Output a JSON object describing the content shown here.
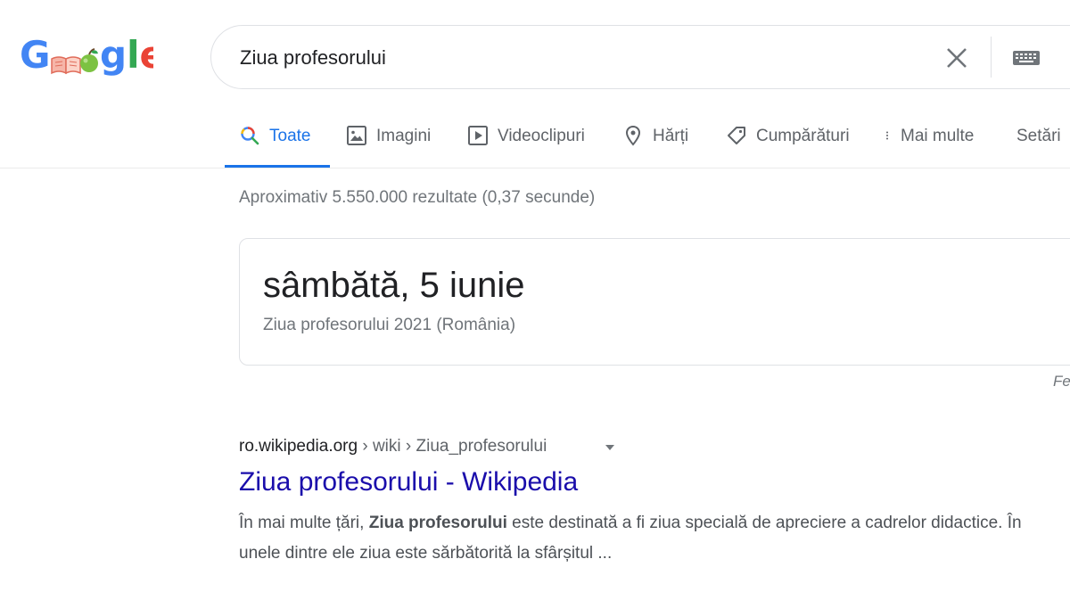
{
  "logo": {
    "letters": [
      "G",
      "gle"
    ],
    "colors": {
      "blue": "#4285f4",
      "red": "#ea4335",
      "yellow": "#fbbc05",
      "green": "#34a853",
      "apple_green": "#7cc242"
    }
  },
  "search": {
    "query": "Ziua profesorului",
    "clear_icon": "close-icon",
    "keyboard_icon": "keyboard-icon"
  },
  "tabs": [
    {
      "label": "Toate",
      "icon": "search-icon",
      "active": true
    },
    {
      "label": "Imagini",
      "icon": "image-icon",
      "active": false
    },
    {
      "label": "Videoclipuri",
      "icon": "video-icon",
      "active": false
    },
    {
      "label": "Hărți",
      "icon": "map-pin-icon",
      "active": false
    },
    {
      "label": "Cumpărături",
      "icon": "tag-icon",
      "active": false
    },
    {
      "label": "Mai multe",
      "icon": "more-vert-icon",
      "active": false
    },
    {
      "label": "Setări",
      "icon": "",
      "active": false
    }
  ],
  "stats": "Aproximativ 5.550.000 rezultate (0,37 secunde)",
  "answer": {
    "date": "sâmbătă, 5 iunie",
    "subtitle": "Ziua profesorului 2021 (România)",
    "feedback": "Fe"
  },
  "result": {
    "domain": "ro.wikipedia.org",
    "breadcrumb": " › wiki › Ziua_profesorului",
    "title": "Ziua profesorului - Wikipedia",
    "snippet_prefix": "În mai multe țări, ",
    "snippet_bold": "Ziua profesorului",
    "snippet_suffix": " este destinată a fi ziua specială de apreciere a cadrelor didactice. În unele dintre ele ziua este sărbătorită la sfârșitul ..."
  },
  "colors": {
    "accent": "#1a73e8",
    "link": "#1a0dab",
    "muted": "#70757a",
    "border": "#dfe1e5"
  }
}
